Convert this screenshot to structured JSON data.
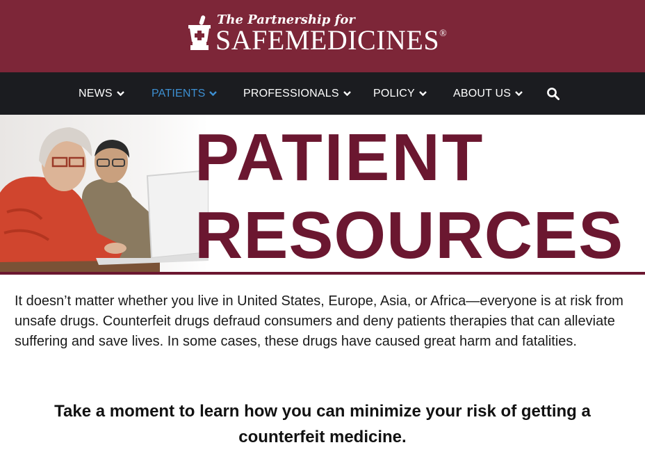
{
  "header": {
    "tagline": "The Partnership for",
    "brand": "SAFEMEDICINES",
    "registered": "®",
    "bg_color": "#7d2638"
  },
  "nav": {
    "items": [
      {
        "label": "NEWS",
        "active": false
      },
      {
        "label": "PATIENTS",
        "active": true
      },
      {
        "label": "PROFESSIONALS",
        "active": false
      },
      {
        "label": "POLICY",
        "active": false
      },
      {
        "label": "ABOUT US",
        "active": false
      }
    ],
    "search_icon": "search-icon",
    "bg_color": "#1b1c20",
    "active_color": "#3d8fd1"
  },
  "hero": {
    "line1": "PATIENT",
    "line2": "RESOURCES",
    "text_color": "#6b1730"
  },
  "content": {
    "intro": "It doesn’t matter whether you live in United States, Europe, Asia, or Africa—everyone is at risk from unsafe drugs. Counterfeit drugs defraud consumers and deny patients therapies that can alleviate suffering and save lives. In some cases, these drugs have caused great harm and fatalities.",
    "callout": "Take a moment to learn how you can minimize your risk of getting a counterfeit medicine."
  }
}
